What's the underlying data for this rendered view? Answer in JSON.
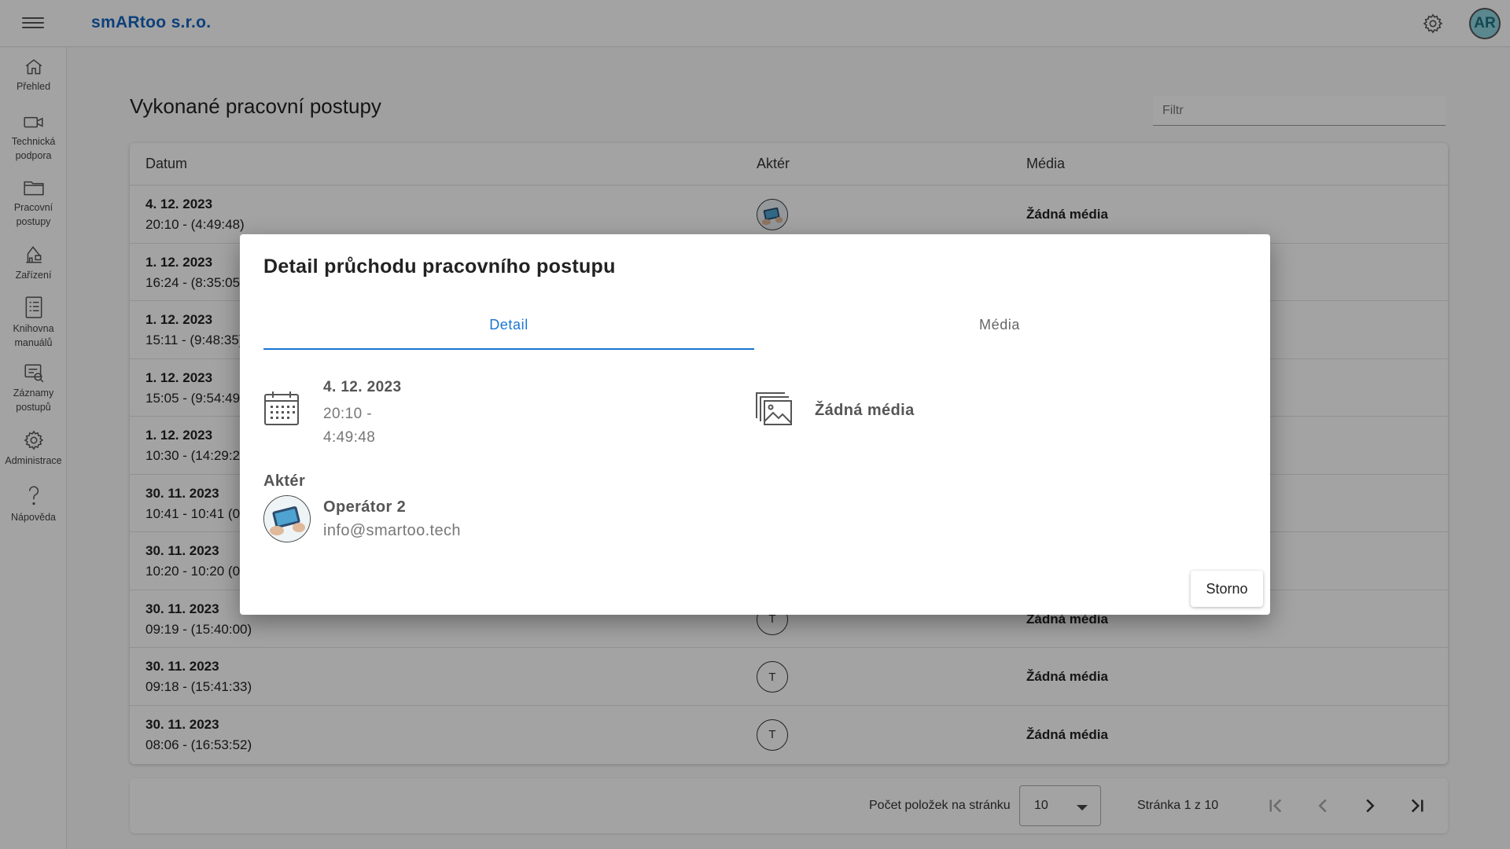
{
  "app": {
    "brand": "smARtoo s.r.o.",
    "user_initials": "AR"
  },
  "sidebar": {
    "items": [
      {
        "label": "Přehled",
        "icon": "home-icon"
      },
      {
        "label": "Technická podpora",
        "icon": "video-camera-icon"
      },
      {
        "label": "Pracovní postupy",
        "icon": "folder-icon"
      },
      {
        "label": "Zařízení",
        "icon": "crane-icon"
      },
      {
        "label": "Knihovna manuálů",
        "icon": "manual-list-icon"
      },
      {
        "label": "Záznamy postupů",
        "icon": "records-icon"
      },
      {
        "label": "Administrace",
        "icon": "gear-icon"
      },
      {
        "label": "Nápověda",
        "icon": "question-icon"
      }
    ]
  },
  "main": {
    "title": "Vykonané pracovní postupy",
    "filter_placeholder": "Filtr",
    "table": {
      "headers": [
        "Datum",
        "Aktér",
        "Média"
      ],
      "rows": [
        {
          "date": "4. 12. 2023",
          "time": "20:10 - (4:49:48)",
          "actor": "photo",
          "media": "Žádná média"
        },
        {
          "date": "1. 12. 2023",
          "time": "16:24 - (8:35:05)",
          "actor": "",
          "media": ""
        },
        {
          "date": "1. 12. 2023",
          "time": "15:11 - (9:48:35)",
          "actor": "",
          "media": ""
        },
        {
          "date": "1. 12. 2023",
          "time": "15:05 - (9:54:49)",
          "actor": "",
          "media": ""
        },
        {
          "date": "1. 12. 2023",
          "time": "10:30 - (14:29:2",
          "actor": "",
          "media": ""
        },
        {
          "date": "30. 11. 2023",
          "time": "10:41 - 10:41 (0",
          "actor": "",
          "media": ""
        },
        {
          "date": "30. 11. 2023",
          "time": "10:20 - 10:20 (0",
          "actor": "",
          "media": ""
        },
        {
          "date": "30. 11. 2023",
          "time": "09:19 - (15:40:00)",
          "actor": "T",
          "media": "Žádná média"
        },
        {
          "date": "30. 11. 2023",
          "time": "09:18 - (15:41:33)",
          "actor": "T",
          "media": "Žádná média"
        },
        {
          "date": "30. 11. 2023",
          "time": "08:06 - (16:53:52)",
          "actor": "T",
          "media": "Žádná média"
        }
      ]
    },
    "pagination": {
      "per_page_label": "Počet položek na stránku",
      "per_page_value": "10",
      "page_label": "Stránka 1 z 10"
    }
  },
  "dialog": {
    "title": "Detail průchodu pracovního postupu",
    "tabs": {
      "detail": "Detail",
      "media": "Média"
    },
    "date": "4. 12. 2023",
    "time": "20:10 - 4:49:48",
    "no_media": "Žádná média",
    "actor_label": "Aktér",
    "actor_name": "Operátor 2",
    "actor_email": "info@smartoo.tech",
    "cancel_label": "Storno"
  },
  "colors": {
    "brand": "#1565c0",
    "accent": "#1976d2",
    "overlay": "rgba(0,0,0,0.36)"
  }
}
